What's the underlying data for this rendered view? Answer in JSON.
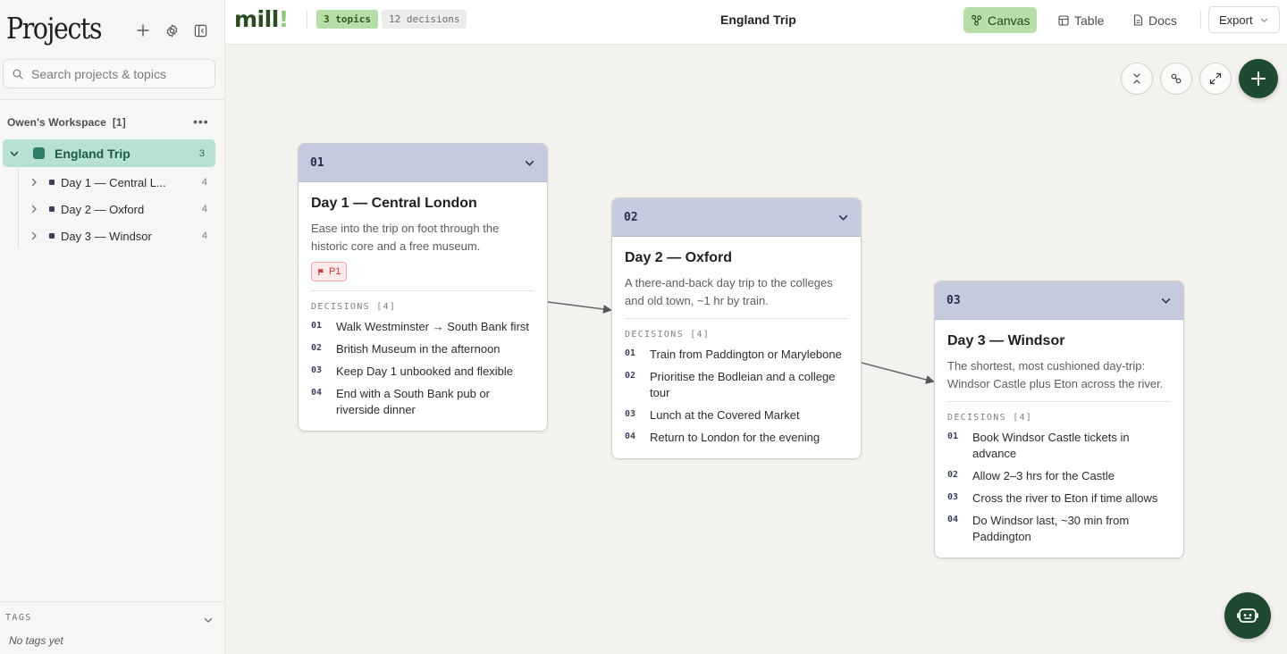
{
  "sidebar": {
    "title": "Projects",
    "search_placeholder": "Search projects & topics",
    "workspace": "Owen's Workspace",
    "workspace_count": "[1]",
    "project": {
      "name": "England Trip",
      "count": "3"
    },
    "topics": [
      {
        "name": "Day 1 — Central L...",
        "count": "4"
      },
      {
        "name": "Day 2 — Oxford",
        "count": "4"
      },
      {
        "name": "Day 3 — Windsor",
        "count": "4"
      }
    ],
    "tags_label": "TAGS",
    "no_tags": "No tags yet"
  },
  "topbar": {
    "logo": "mill",
    "logo_bang": "!",
    "topics_badge": "3 topics",
    "decisions_badge": "12 decisions",
    "title": "England Trip",
    "views": [
      "Canvas",
      "Table",
      "Docs"
    ],
    "export_label": "Export"
  },
  "cards": [
    {
      "num": "01",
      "title": "Day 1 — Central London",
      "desc": "Ease into the trip on foot through the historic core and a free museum.",
      "priority": "P1",
      "decisions_label": "DECISIONS [4]",
      "decisions": [
        {
          "n": "01",
          "t": "Walk Westminster → South Bank first"
        },
        {
          "n": "02",
          "t": "British Museum in the afternoon"
        },
        {
          "n": "03",
          "t": "Keep Day 1 unbooked and flexible"
        },
        {
          "n": "04",
          "t": "End with a South Bank pub or riverside dinner"
        }
      ]
    },
    {
      "num": "02",
      "title": "Day 2 — Oxford",
      "desc": "A there-and-back day trip to the colleges and old town, ~1 hr by train.",
      "decisions_label": "DECISIONS [4]",
      "decisions": [
        {
          "n": "01",
          "t": "Train from Paddington or Marylebone"
        },
        {
          "n": "02",
          "t": "Prioritise the Bodleian and a college tour"
        },
        {
          "n": "03",
          "t": "Lunch at the Covered Market"
        },
        {
          "n": "04",
          "t": "Return to London for the evening"
        }
      ]
    },
    {
      "num": "03",
      "title": "Day 3 — Windsor",
      "desc": "The shortest, most cushioned day-trip: Windsor Castle plus Eton across the river.",
      "decisions_label": "DECISIONS [4]",
      "decisions": [
        {
          "n": "01",
          "t": "Book Windsor Castle tickets in advance"
        },
        {
          "n": "02",
          "t": "Allow 2–3 hrs for the Castle"
        },
        {
          "n": "03",
          "t": "Cross the river to Eton if time allows"
        },
        {
          "n": "04",
          "t": "Do Windsor last, ~30 min from Paddington"
        }
      ]
    }
  ],
  "icons": {
    "sidebar_tools": [
      "plus-icon",
      "gear-icon",
      "sidebar-toggle-icon"
    ],
    "canvas_controls": [
      "collapse-icon",
      "link-icon",
      "expand-icon",
      "plus-icon"
    ],
    "assistant": "bot-icon"
  },
  "colors": {
    "accent_green": "#b8dea8",
    "project_highlight": "#b6e1d4",
    "card_header": "#c6cadf",
    "fab": "#1f4a30",
    "priority_red": "#c0393b"
  }
}
